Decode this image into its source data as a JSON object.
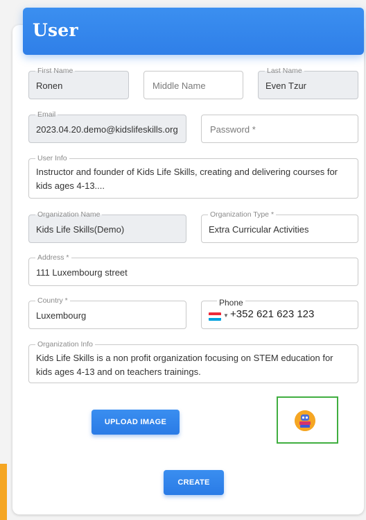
{
  "header": {
    "title": "User"
  },
  "form": {
    "first_name": {
      "label": "First Name",
      "value": "Ronen"
    },
    "middle_name": {
      "placeholder": "Middle Name"
    },
    "last_name": {
      "label": "Last Name",
      "value": "Even Tzur"
    },
    "email": {
      "label": "Email",
      "value": "2023.04.20.demo@kidslifeskills.org"
    },
    "password": {
      "placeholder": "Password *"
    },
    "user_info": {
      "label": "User Info",
      "value": "Instructor and founder of Kids Life Skills, creating and delivering courses for kids ages 4-13...."
    },
    "organization_name": {
      "label": "Organization Name",
      "value": "Kids Life Skills(Demo)"
    },
    "organization_type": {
      "label": "Organization Type *",
      "value": "Extra Curricular Activities"
    },
    "address": {
      "label": "Address *",
      "value": "111 Luxembourg street"
    },
    "country": {
      "label": "Country *",
      "value": "Luxembourg"
    },
    "phone": {
      "label": "Phone",
      "value": "+352 621 623 123",
      "flag_icon": "luxembourg-flag-icon"
    },
    "organization_info": {
      "label": "Organization Info",
      "value": "Kids Life Skills is a non profit organization focusing on STEM education for kids ages 4-13 and on teachers trainings."
    }
  },
  "buttons": {
    "upload_image": "UPLOAD IMAGE",
    "create": "CREATE"
  },
  "colors": {
    "primary": "#2f7fe8",
    "selection_border": "#3fae3f",
    "accent_orange": "#f5a623"
  }
}
